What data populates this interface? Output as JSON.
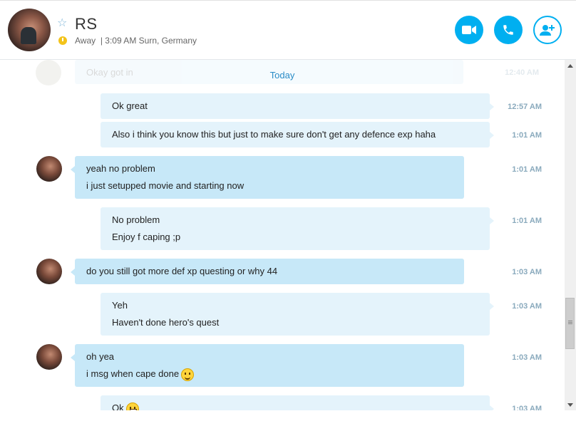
{
  "header": {
    "name": "RS",
    "status": "Away",
    "separator": "|",
    "local_time": "3:09 AM Surn, Germany",
    "buttons": {
      "video": "video-call",
      "voice": "voice-call",
      "add": "add-participant"
    }
  },
  "chat": {
    "previous_partial": {
      "text": "Okay got in",
      "time": "12:40 AM"
    },
    "day_divider": "Today",
    "messages": [
      {
        "direction": "out",
        "lines": [
          "Ok great"
        ],
        "time": "12:57 AM"
      },
      {
        "direction": "out",
        "lines": [
          "Also i think you know this but just to make sure don't get any defence exp haha"
        ],
        "time": "1:01 AM"
      },
      {
        "direction": "in",
        "lines": [
          "yeah no problem",
          "i just setupped movie and starting now"
        ],
        "time": "1:01 AM"
      },
      {
        "direction": "out",
        "lines": [
          "No problem",
          "Enjoy f caping ;p"
        ],
        "time": "1:01 AM"
      },
      {
        "direction": "in",
        "lines": [
          "do you still got more def xp questing or why 44"
        ],
        "time": "1:03 AM"
      },
      {
        "direction": "out",
        "lines": [
          "Yeh",
          "Haven't done hero's quest"
        ],
        "time": "1:03 AM"
      },
      {
        "direction": "in",
        "lines": [
          "oh yea",
          "i msg when cape done"
        ],
        "emoji": "smile",
        "time": "1:03 AM"
      },
      {
        "direction": "out",
        "lines": [
          "Ok"
        ],
        "emoji": "grin",
        "time": "1:03 AM"
      }
    ]
  },
  "colors": {
    "accent": "#00aff0",
    "incoming_bubble": "#c7e8f8",
    "outgoing_bubble": "#e4f3fb",
    "away": "#f3c31a"
  }
}
